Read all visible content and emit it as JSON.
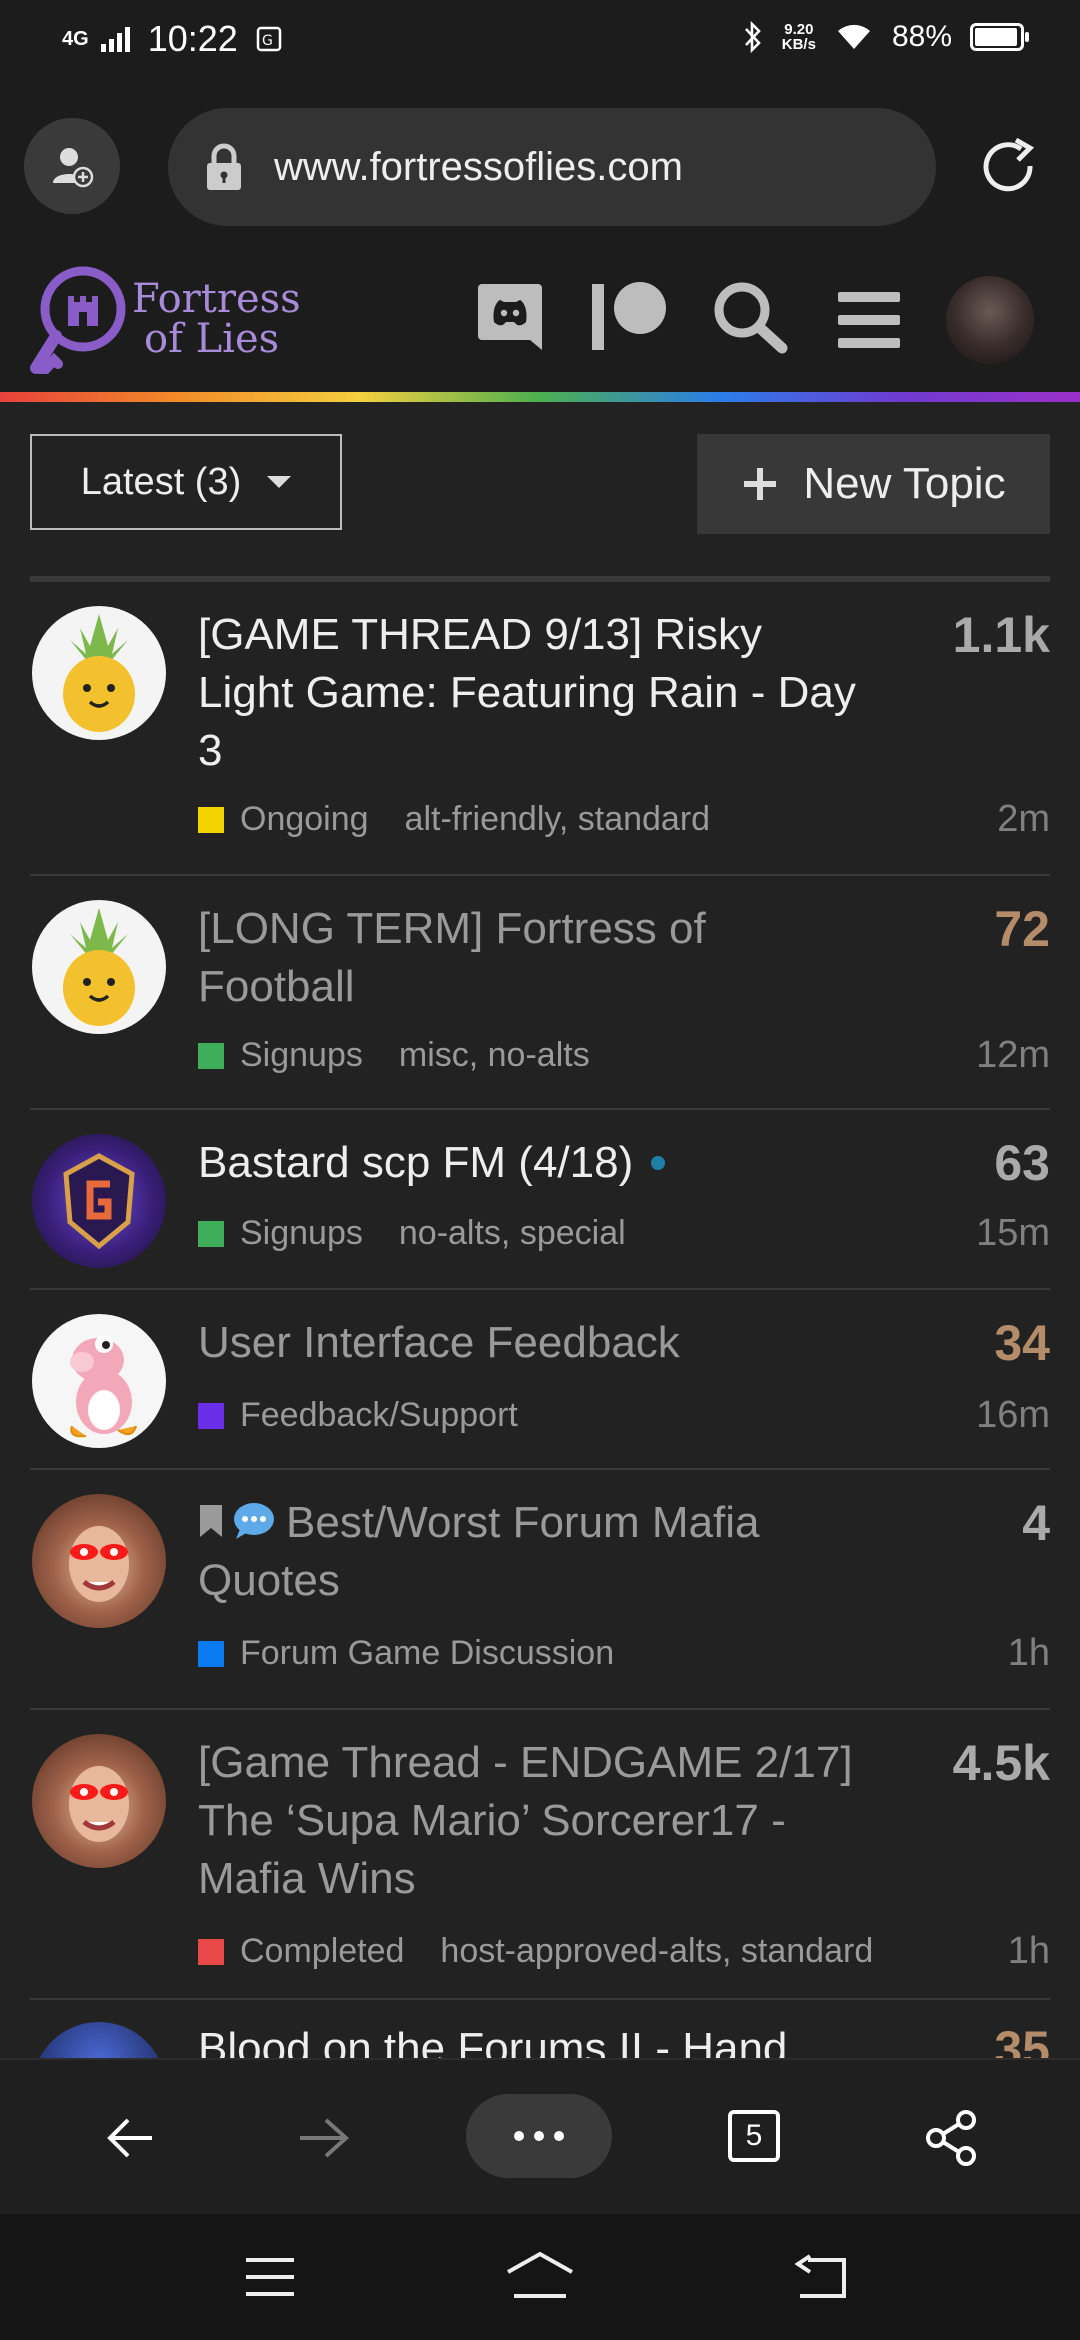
{
  "status_bar": {
    "network": "4G",
    "time": "10:22",
    "speed_value": "9.20",
    "speed_unit": "KB/s",
    "battery": "88%",
    "battery_level": 0.88
  },
  "browser": {
    "url": "www.fortressoflies.com",
    "tab_count": "5"
  },
  "site": {
    "logo_line1": "Fortress",
    "logo_line2": "of Lies"
  },
  "controls": {
    "latest_label": "Latest (3)",
    "new_topic_label": "New Topic"
  },
  "topics": [
    {
      "title": "[GAME THREAD 9/13] Risky Light Game: Featuring Rain - Day 3",
      "category": "Ongoing",
      "category_color": "#f4d400",
      "tags": "alt-friendly, standard",
      "count": "1.1k",
      "age": "2m"
    },
    {
      "title": "[LONG TERM] Fortress of Football",
      "category": "Signups",
      "category_color": "#3fae5b",
      "tags": "misc, no-alts",
      "count": "72",
      "age": "12m"
    },
    {
      "title": "Bastard scp FM (4/18)",
      "category": "Signups",
      "category_color": "#3fae5b",
      "tags": "no-alts, special",
      "count": "63",
      "age": "15m"
    },
    {
      "title": "User Interface Feedback",
      "category": "Feedback/Support",
      "category_color": "#6b2ee8",
      "tags": "",
      "count": "34",
      "age": "16m"
    },
    {
      "title": "Best/Worst Forum Mafia Quotes",
      "category": "Forum Game Discussion",
      "category_color": "#0a7af0",
      "tags": "",
      "count": "4",
      "age": "1h"
    },
    {
      "title": "[Game Thread - ENDGAME 2/17] The ‘Supa Mario’ Sorcerer17 - Mafia Wins",
      "category": "Completed",
      "category_color": "#e84848",
      "tags": "host-approved-alts, standard",
      "count": "4.5k",
      "age": "1h"
    },
    {
      "title": "Blood on the Forums II - Hand",
      "count": "35"
    }
  ]
}
